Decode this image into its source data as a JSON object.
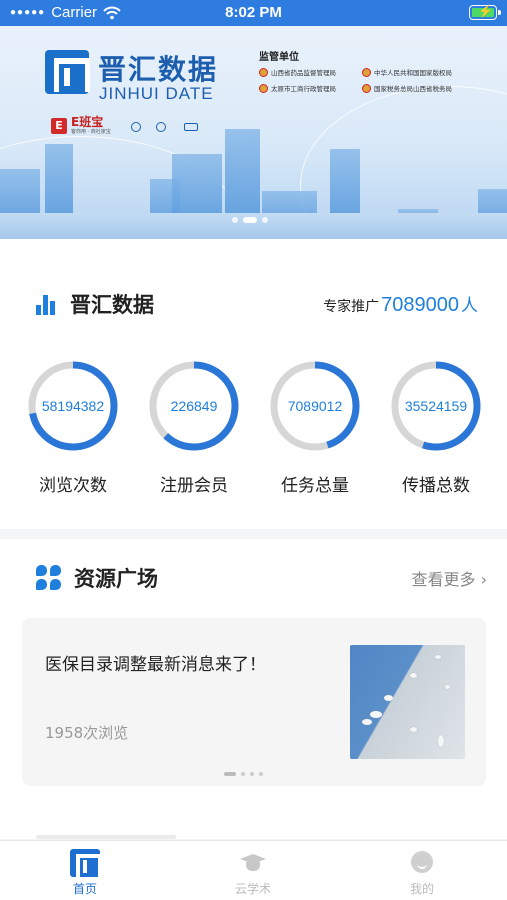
{
  "status_bar": {
    "carrier": "Carrier",
    "time": "8:02 PM",
    "icons": [
      "wifi-icon",
      "battery-charging-icon"
    ]
  },
  "banner": {
    "brand": "晋汇数据",
    "brand_en": "JINHUI DATE",
    "partner_logo": "E班宝",
    "partner_sub": "客你用 · 商社家宝",
    "regulator_title": "监管单位",
    "regulators": [
      "山西省药品监督管理局",
      "中华人民共和国国家版权局",
      "太原市工商行政管理局",
      "国家税务总局山西省税务局"
    ],
    "page_count": 3,
    "active_page": 1
  },
  "stats": {
    "title": "晋汇数据",
    "expert_prefix": "专家推广",
    "expert_count": "7089000",
    "expert_unit": "人",
    "items": [
      {
        "value": "58194382",
        "label": "浏览次数",
        "progress": 0.72
      },
      {
        "value": "226849",
        "label": "注册会员",
        "progress": 0.62
      },
      {
        "value": "7089012",
        "label": "任务总量",
        "progress": 0.45
      },
      {
        "value": "35524159",
        "label": "传播总数",
        "progress": 0.55
      }
    ],
    "colors": {
      "ring_fill": "#2b77d8",
      "ring_track": "#d6d6d6"
    }
  },
  "resource": {
    "title": "资源广场",
    "more_label": "查看更多",
    "card": {
      "title": "医保目录调整最新消息来了！",
      "views": "1958次浏览"
    },
    "page_count": 4,
    "active_page": 0
  },
  "tabs": [
    {
      "label": "首页",
      "icon": "home-logo-icon",
      "active": true
    },
    {
      "label": "云学术",
      "icon": "graduation-cap-icon",
      "active": false
    },
    {
      "label": "我的",
      "icon": "profile-icon",
      "active": false
    }
  ],
  "colors": {
    "accent": "#1f7fdc",
    "status_bar": "#2f7ce0",
    "tab_active": "#1f6fd0"
  }
}
